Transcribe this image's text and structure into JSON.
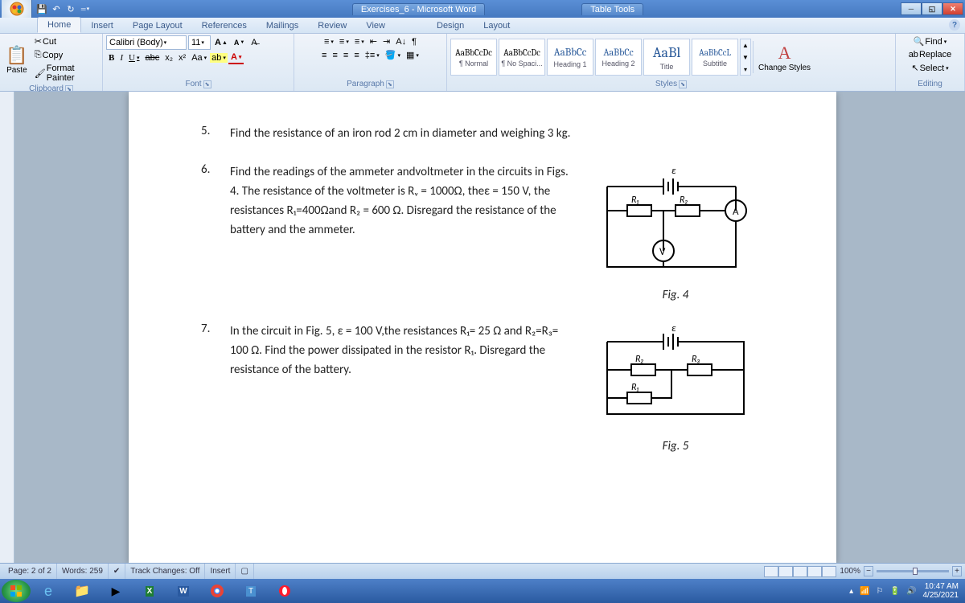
{
  "window": {
    "title": "Exercises_6 - Microsoft Word",
    "context_title": "Table Tools"
  },
  "qat": {
    "save": "💾",
    "undo": "↶",
    "redo": "↻"
  },
  "tabs": {
    "items": [
      "Home",
      "Insert",
      "Page Layout",
      "References",
      "Mailings",
      "Review",
      "View"
    ],
    "context": [
      "Design",
      "Layout"
    ],
    "active": "Home"
  },
  "ribbon": {
    "clipboard": {
      "label": "Clipboard",
      "paste": "Paste",
      "cut": "Cut",
      "copy": "Copy",
      "fmt": "Format Painter"
    },
    "font": {
      "label": "Font",
      "name": "Calibri (Body)",
      "size": "11",
      "bold": "B",
      "italic": "I",
      "underline": "U",
      "strike": "abc",
      "sub": "x₂",
      "sup": "x²",
      "case": "Aa",
      "highlight": "ab",
      "color": "A",
      "grow": "A",
      "shrink": "A",
      "clear": "Aᵃ"
    },
    "paragraph": {
      "label": "Paragraph"
    },
    "styles": {
      "label": "Styles",
      "items": [
        {
          "preview": "AaBbCcDc",
          "name": "¶ Normal",
          "size": "11px"
        },
        {
          "preview": "AaBbCcDc",
          "name": "¶ No Spaci...",
          "size": "11px"
        },
        {
          "preview": "AaBbCc",
          "name": "Heading 1",
          "size": "13px",
          "color": "#2a5a9a"
        },
        {
          "preview": "AaBbCc",
          "name": "Heading 2",
          "size": "12px",
          "color": "#2a5a9a"
        },
        {
          "preview": "AaBl",
          "name": "Title",
          "size": "18px",
          "color": "#2a5a9a"
        },
        {
          "preview": "AaBbCcL",
          "name": "Subtitle",
          "size": "11px",
          "color": "#2a5a9a"
        }
      ],
      "change": "Change Styles"
    },
    "editing": {
      "label": "Editing",
      "find": "Find",
      "replace": "Replace",
      "select": "Select"
    }
  },
  "doc": {
    "q5": {
      "num": "5.",
      "text": "Find the resistance of an iron rod 2 cm in diameter and weighing 3 kg."
    },
    "q6": {
      "num": "6.",
      "text": "Find the readings of the ammeter andvoltmeter in the circuits in Figs. 4. The resistance of the voltmeter is Rᵥ = 1000Ω, theε = 150 V, the resistances R₁=400Ωand R₂ = 600 Ω. Disregard the resistance of the battery and the ammeter.",
      "figlabel": "Fig. 4"
    },
    "q7": {
      "num": "7.",
      "text": "In the circuit in Fig. 5, ε = 100 V,the resistances R₁= 25 Ω and R₂=R₃= 100 Ω. Find the power dissipated in the resistor R₁. Disregard the resistance of the battery.",
      "figlabel": "Fig. 5"
    }
  },
  "status": {
    "page": "Page: 2 of 2",
    "words": "Words: 259",
    "track": "Track Changes: Off",
    "insert": "Insert",
    "zoom": "100%"
  },
  "tray": {
    "time": "10:47 AM",
    "date": "4/25/2021"
  }
}
